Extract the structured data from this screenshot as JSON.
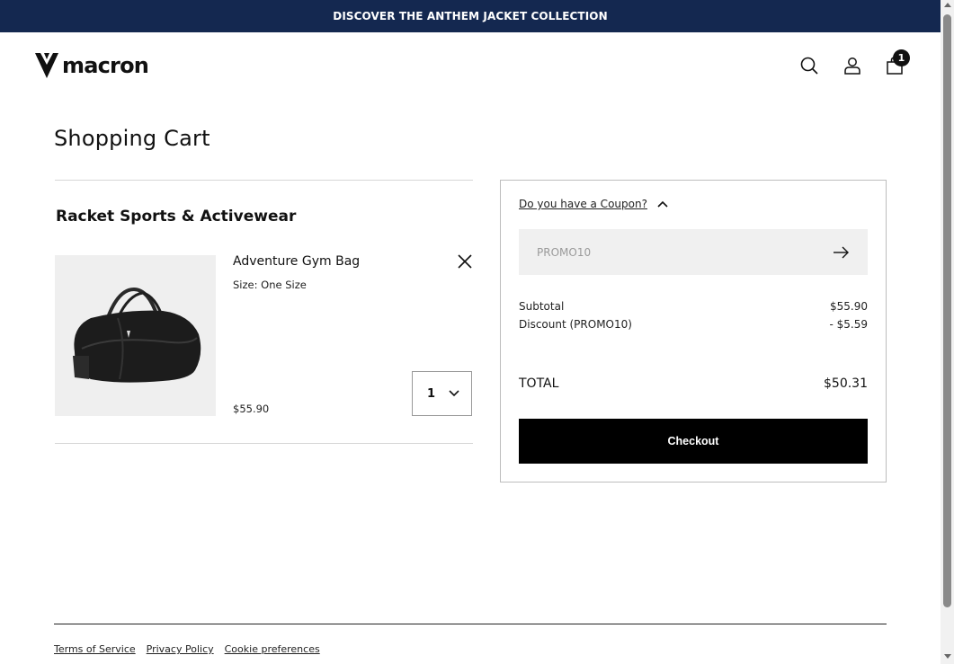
{
  "announcement": "DISCOVER THE ANTHEM JACKET COLLECTION",
  "header": {
    "logo_text": "macron",
    "cart_count": "1",
    "icons": [
      "search-icon",
      "user-icon",
      "shopping-bag-icon"
    ]
  },
  "page": {
    "title": "Shopping Cart"
  },
  "cart": {
    "section_title": "Racket Sports & Activewear",
    "item": {
      "name": "Adventure Gym Bag",
      "size": "Size: One Size",
      "price": "$55.90",
      "quantity": "1"
    }
  },
  "summary": {
    "coupon_prompt": "Do you have a Coupon?",
    "coupon_value": "PROMO10",
    "subtotal_label": "Subtotal",
    "subtotal_value": "$55.90",
    "discount_label": "Discount (PROMO10)",
    "discount_value": "- $5.59",
    "total_label": "TOTAL",
    "total_value": "$50.31",
    "checkout_label": "Checkout"
  },
  "footer": {
    "links": [
      "Terms of Service",
      "Privacy Policy",
      "Cookie preferences"
    ]
  },
  "colors": {
    "announcement_bg": "#142850",
    "accent": "#000000"
  }
}
